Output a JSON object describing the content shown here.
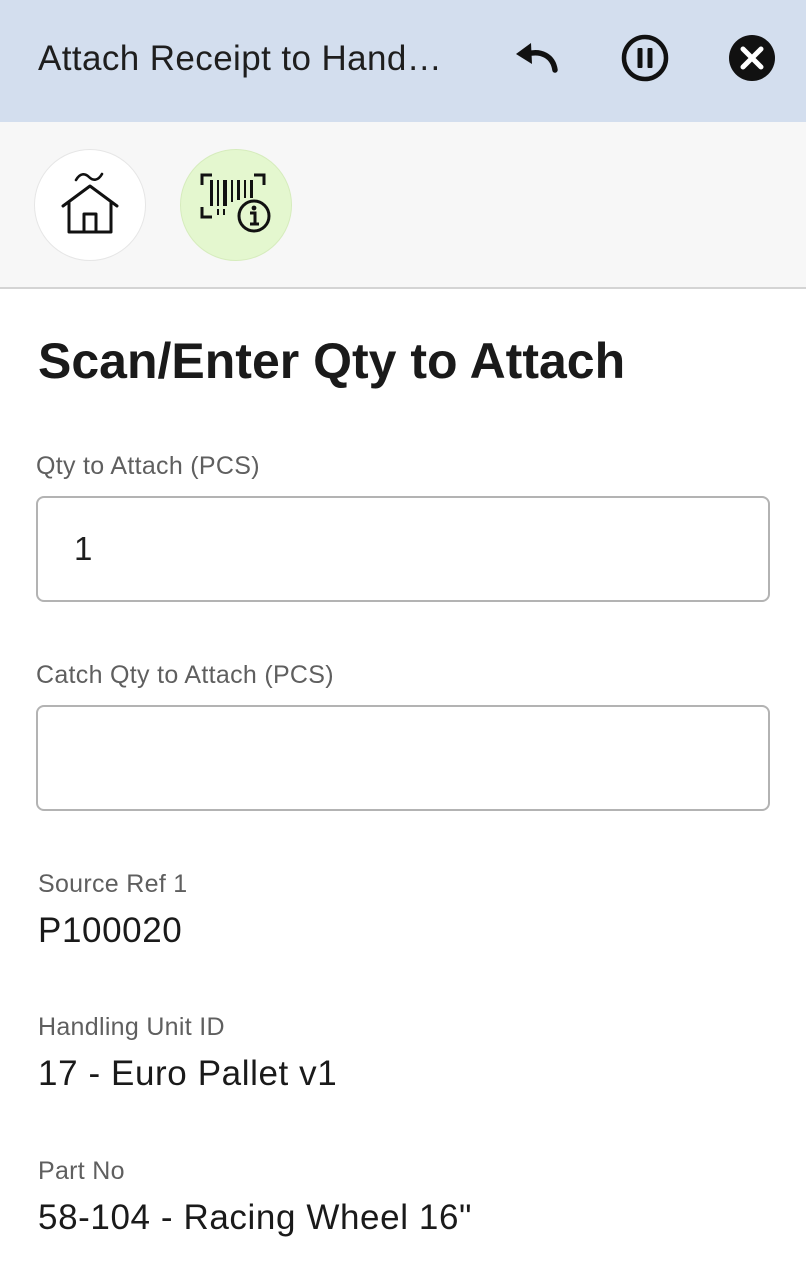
{
  "header": {
    "title": "Attach Receipt to Hand…",
    "undo_icon": "undo-icon",
    "pause_icon": "pause-circle-icon",
    "close_icon": "close-circle-icon",
    "background": "#d3deee"
  },
  "toolbar": {
    "home_icon": "home-icon",
    "scan_info_icon": "barcode-info-icon",
    "scan_button_color": "#e4f7cf"
  },
  "main": {
    "title": "Scan/Enter Qty to Attach",
    "fields": [
      {
        "label": "Qty to Attach (PCS)",
        "value": "1"
      },
      {
        "label": "Catch Qty to Attach (PCS)",
        "value": ""
      }
    ],
    "info": [
      {
        "label": "Source Ref 1",
        "value": "P100020"
      },
      {
        "label": "Handling Unit ID",
        "value": "17 - Euro Pallet v1"
      },
      {
        "label": "Part No",
        "value": "58-104 - Racing Wheel 16\""
      }
    ]
  }
}
